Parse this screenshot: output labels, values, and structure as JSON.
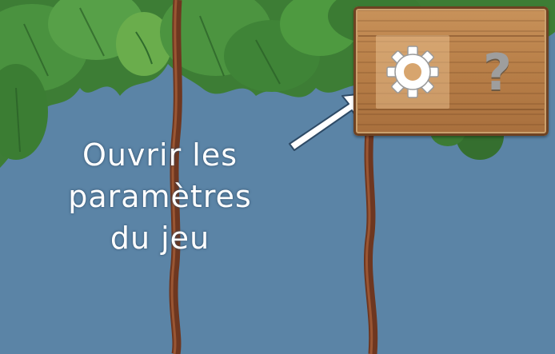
{
  "tooltip": {
    "line1": "Ouvrir les",
    "line2": "paramètres",
    "line3": "du jeu"
  },
  "sign": {
    "buttons": [
      {
        "name": "settings",
        "icon": "gear-icon"
      },
      {
        "name": "help",
        "icon": "question-mark-icon",
        "glyph": "?"
      }
    ]
  },
  "colors": {
    "sky": "#5b84a6",
    "leaf_dark": "#2f6b2c",
    "leaf_light": "#4e9a40",
    "vine": "#7a3e22",
    "wood": "#b98049",
    "tooltip_text": "#ffffff"
  }
}
